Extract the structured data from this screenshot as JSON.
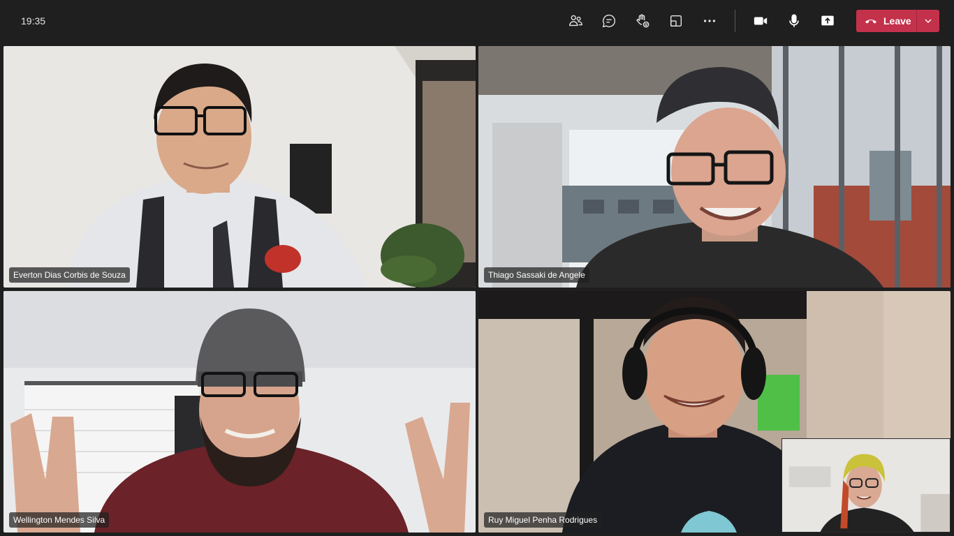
{
  "clock": "19:35",
  "toolbar": {
    "people_icon": "people-icon",
    "chat_icon": "chat-icon",
    "reactions_icon": "raise-hand-reactions-icon",
    "share_tray_icon": "share-tray-icon",
    "more_icon": "more-icon",
    "camera_icon": "camera-icon",
    "mic_icon": "microphone-icon",
    "share_icon": "share-screen-icon",
    "leave_label": "Leave",
    "leave_color": "#c4314b"
  },
  "participants": [
    {
      "name": "Everton Dias Corbis de Souza"
    },
    {
      "name": "Thiago Sassaki de Angele"
    },
    {
      "name": "Wellington Mendes Silva"
    },
    {
      "name": "Ruy Miguel Penha Rodrigues"
    }
  ]
}
